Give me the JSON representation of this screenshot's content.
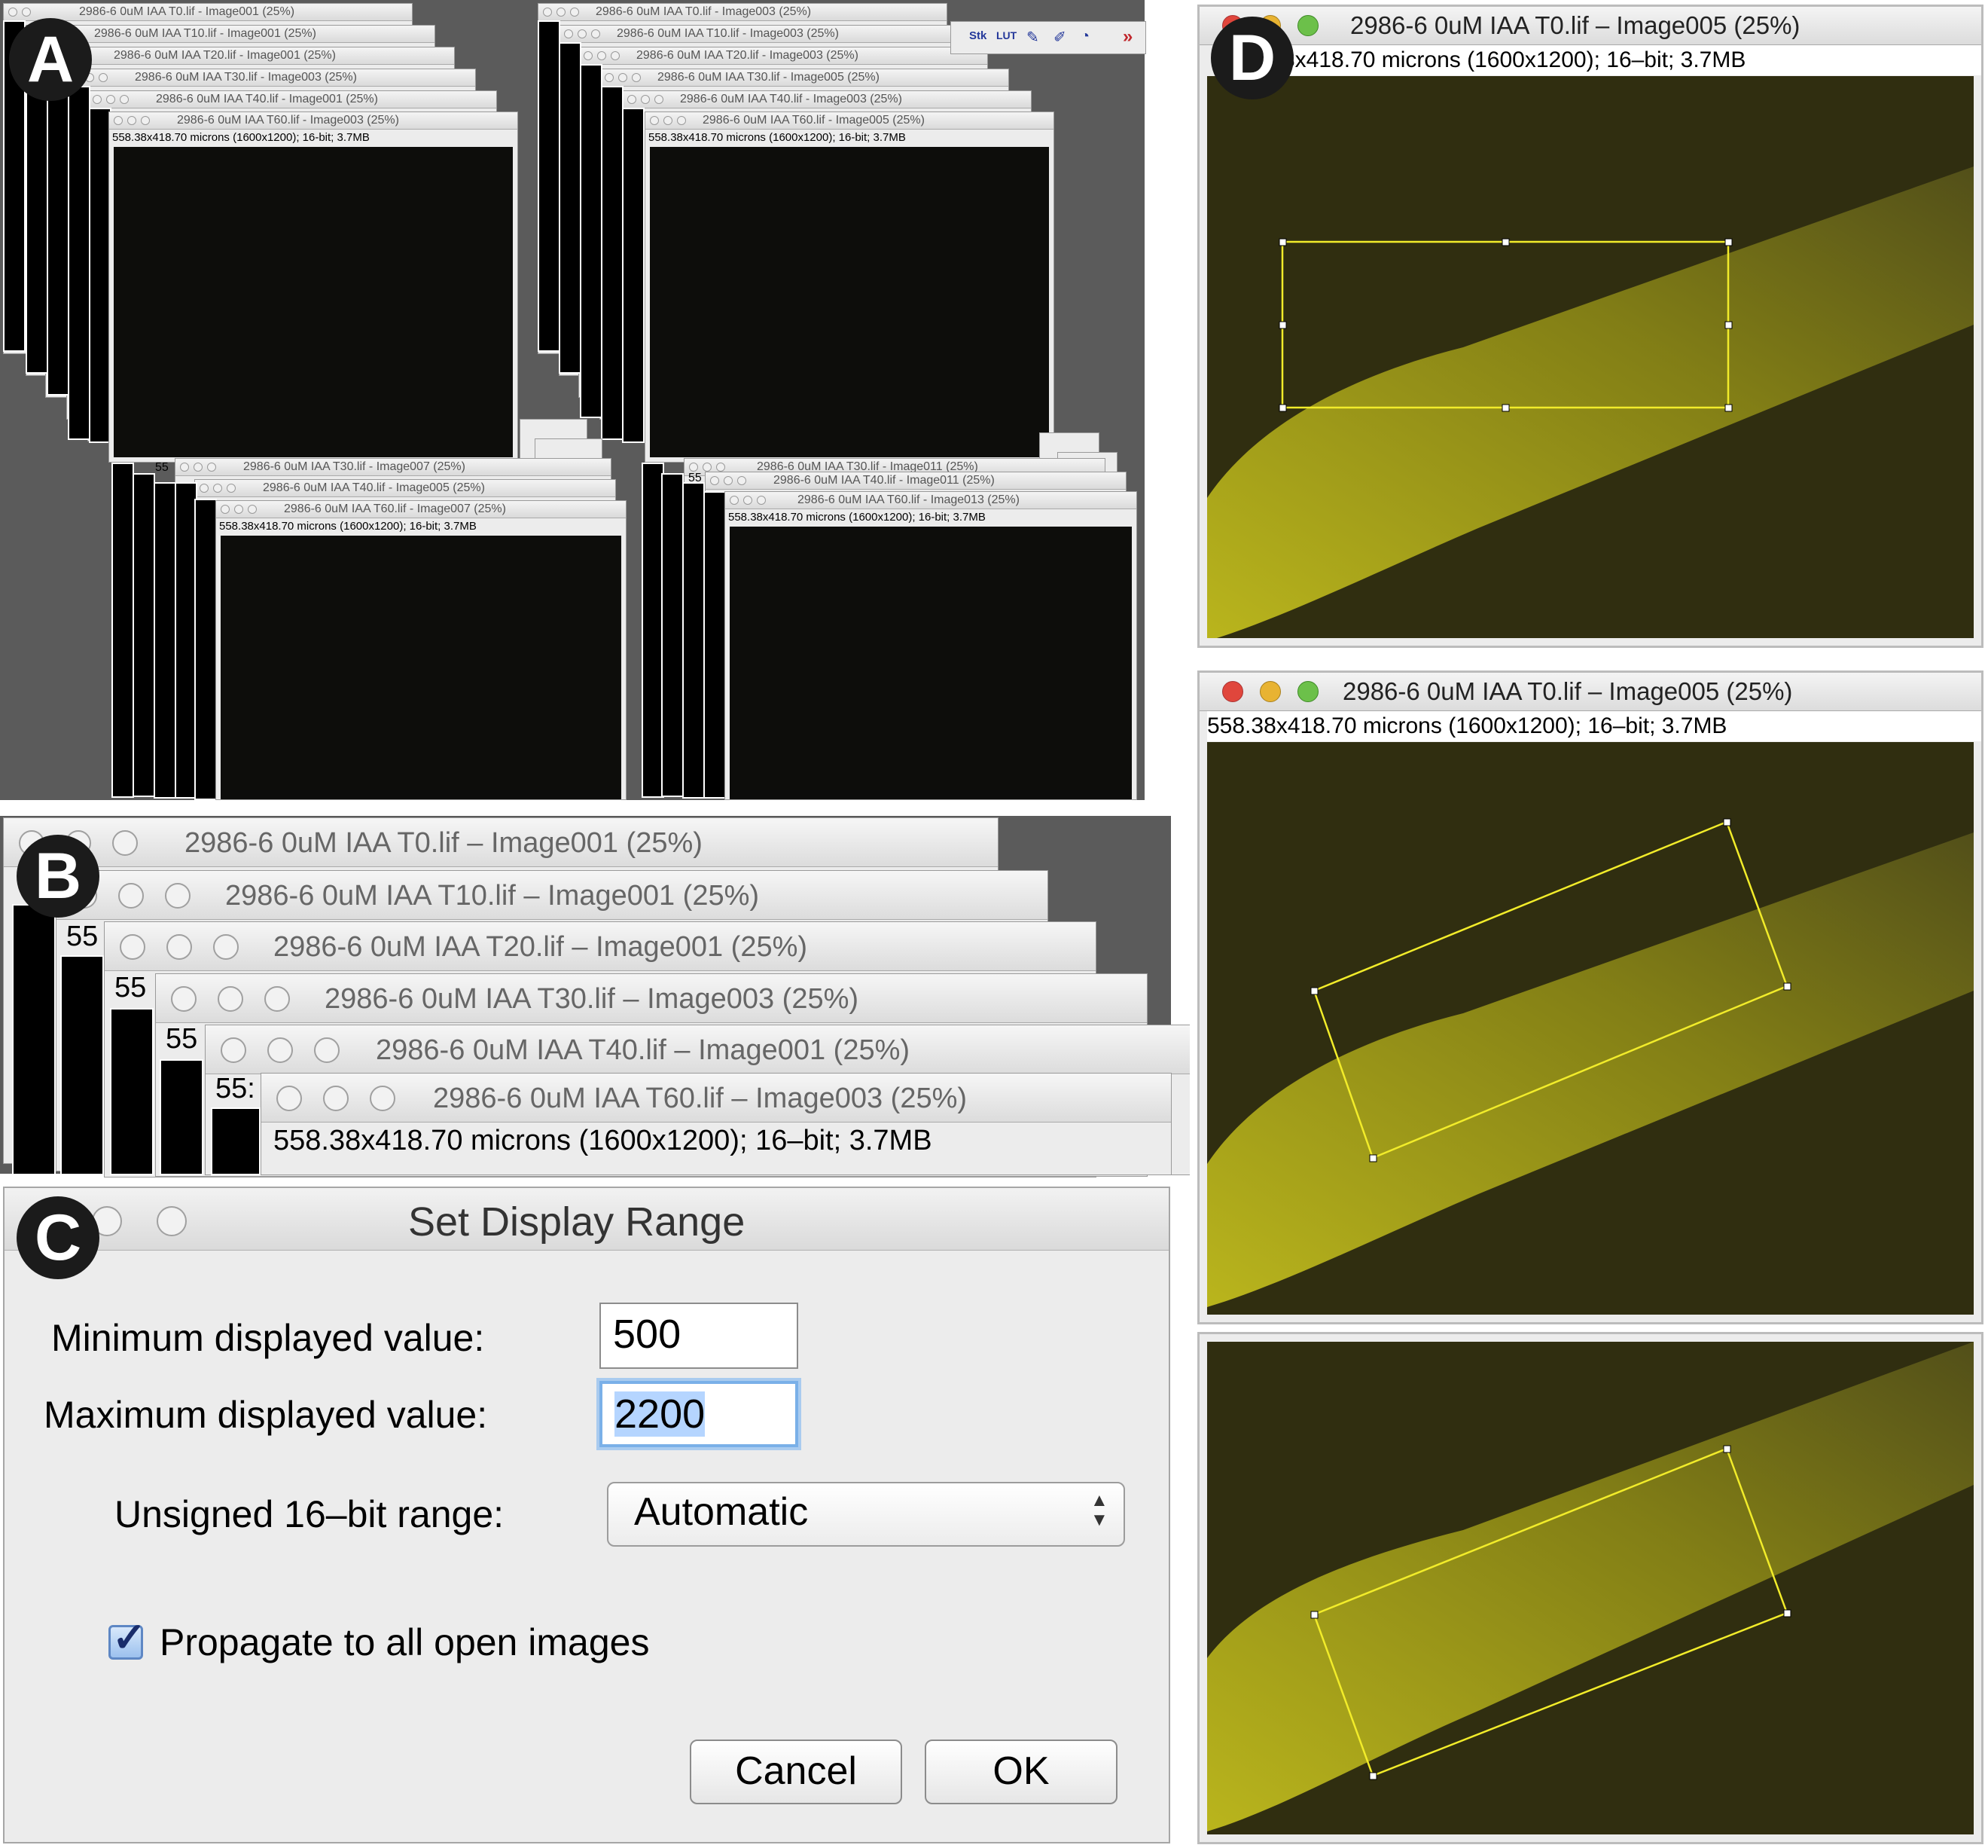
{
  "panel_labels": [
    "A",
    "B",
    "C",
    "D"
  ],
  "panel_a": {
    "info": "558.38x418.70 microns (1600x1200); 16-bit; 3.7MB",
    "stack1_titles": [
      "2986-6 0uM IAA T0.lif - Image001 (25%)",
      "2986-6 0uM IAA T10.lif - Image001 (25%)",
      "2986-6 0uM IAA T20.lif - Image001 (25%)",
      "2986-6 0uM IAA T30.lif - Image003 (25%)",
      "2986-6 0uM IAA T40.lif - Image001 (25%)",
      "2986-6 0uM IAA T60.lif - Image003 (25%)"
    ],
    "stack2_titles": [
      "2986-6 0uM IAA T0.lif - Image003 (25%)",
      "2986-6 0uM IAA T10.lif - Image003 (25%)",
      "2986-6 0uM IAA T20.lif - Image003 (25%)",
      "2986-6 0uM IAA T30.lif - Image005 (25%)",
      "2986-6 0uM IAA T40.lif - Image003 (25%)",
      "2986-6 0uM IAA T60.lif - Image005 (25%)"
    ],
    "stack3_titles": [
      "2986-6 0uM IAA T30.lif - Image007 (25%)",
      "2986-6 0uM IAA T40.lif - Image005 (25%)",
      "2986-6 0uM IAA T60.lif - Image007 (25%)"
    ],
    "stack4_titles": [
      "2986-6 0uM IAA T30.lif - Image011 (25%)",
      "2986-6 0uM IAA T40.lif - Image011 (25%)",
      "2986-6 0uM IAA T60.lif - Image013 (25%)"
    ],
    "strip_label": "55",
    "toolbar": [
      "Stk",
      "LUT",
      "»"
    ]
  },
  "panel_b": {
    "titles": [
      "2986-6 0uM IAA T0.lif – Image001 (25%)",
      "2986-6 0uM IAA T10.lif – Image001 (25%)",
      "2986-6 0uM IAA T20.lif – Image001 (25%)",
      "2986-6 0uM IAA T30.lif – Image003 (25%)",
      "2986-6 0uM IAA T40.lif – Image001 (25%)",
      "2986-6 0uM IAA T60.lif – Image003 (25%)"
    ],
    "strip_labels": [
      "55",
      "55",
      "55",
      "55:"
    ],
    "info": "558.38x418.70 microns (1600x1200); 16–bit; 3.7MB"
  },
  "panel_c": {
    "title": "Set Display Range",
    "min_label": "Minimum displayed value:",
    "min_value": "500",
    "max_label": "Maximum displayed value:",
    "max_value": "2200",
    "range_label": "Unsigned 16–bit range:",
    "range_value": "Automatic",
    "propagate_label": "Propagate to all open images",
    "propagate_checked": true,
    "cancel_label": "Cancel",
    "ok_label": "OK"
  },
  "panel_d": {
    "window1_title": "2986-6 0uM IAA T0.lif – Image005 (25%)",
    "window1_info": "3x418.70 microns (1600x1200); 16–bit; 3.7MB",
    "window2_title": "2986-6 0uM IAA T0.lif – Image005 (25%)",
    "window2_info": "558.38x418.70 microns (1600x1200); 16–bit; 3.7MB",
    "image_color": "#2f2d0f",
    "signal_color": "#b3b01a",
    "roi_color": "#f2ec2a"
  }
}
